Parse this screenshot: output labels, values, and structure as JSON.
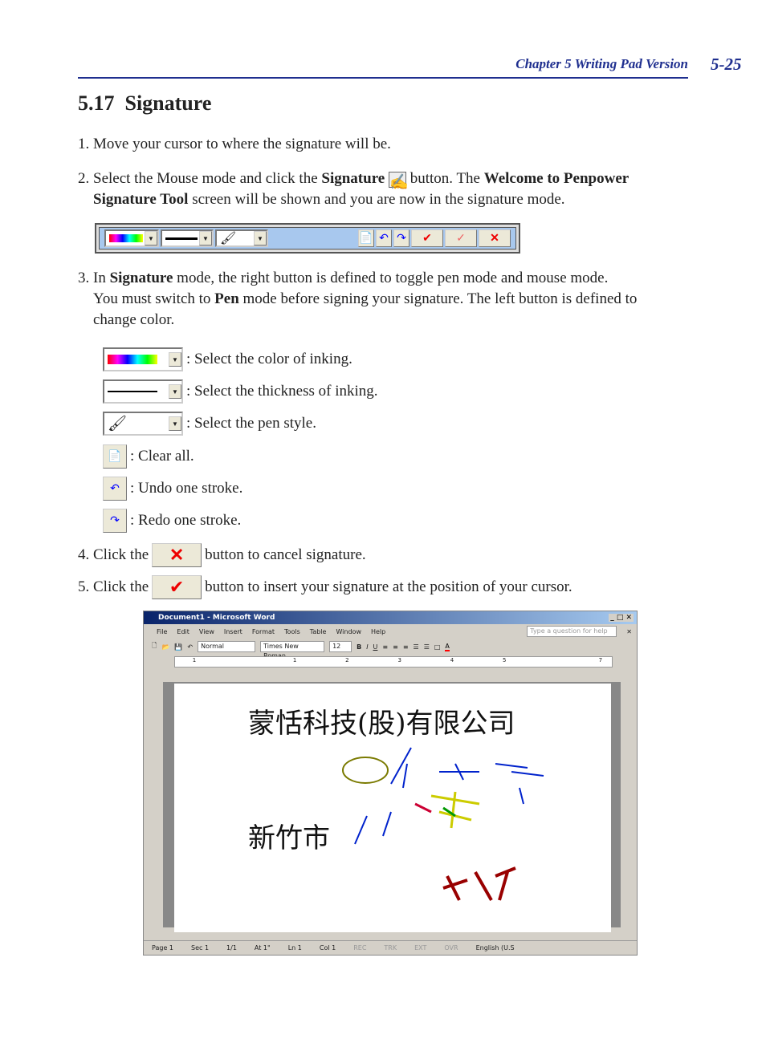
{
  "header": {
    "chapter": "Chapter 5 Writing Pad Version",
    "page": "5-25"
  },
  "section": {
    "number": "5.17",
    "title": "Signature"
  },
  "steps": {
    "s1": "1. Move your cursor to where the signature will be.",
    "s2a": "2. Select the Mouse mode and click the ",
    "s2b": "Signature",
    "s2c": " button. The ",
    "s2d": "Welcome to Penpower",
    "s2e": "Signature Tool",
    "s2f": " screen will be shown and you are now in the signature mode.",
    "s3a": "3. In ",
    "s3b": "Signature",
    "s3c": " mode, the right button is defined to toggle pen mode and mouse mode.",
    "s3d": "You must switch to ",
    "s3e": "Pen",
    "s3f": " mode before signing your signature. The left button is defined to",
    "s3g": "change color.",
    "s4a": "4.  Click the ",
    "s4b": "button to cancel signature.",
    "s5a": "5. Click the ",
    "s5b": "button to insert your signature at the position of your cursor."
  },
  "legend": [
    {
      "icon": "color-select",
      "text": ": Select the color of inking."
    },
    {
      "icon": "thickness-select",
      "text": ": Select the thickness of inking."
    },
    {
      "icon": "pen-style-select",
      "text": ": Select the pen style."
    },
    {
      "icon": "clear-all",
      "text": ": Clear all."
    },
    {
      "icon": "undo",
      "text": ": Undo one stroke."
    },
    {
      "icon": "redo",
      "text": ": Redo one stroke."
    }
  ],
  "word": {
    "title": "Document1 - Microsoft Word",
    "menu": [
      "File",
      "Edit",
      "View",
      "Insert",
      "Format",
      "Tools",
      "Table",
      "Window",
      "Help"
    ],
    "help_placeholder": "Type a question for help",
    "style": "Normal",
    "font": "Times New Roman",
    "size": "12",
    "ruler": [
      "1",
      "1",
      "2",
      "3",
      "4",
      "5",
      "7"
    ],
    "doc_text1": "蒙恬科技(股)有限公司",
    "doc_text2": "新竹市",
    "status": [
      "Page 1",
      "Sec 1",
      "1/1",
      "At 1\"",
      "Ln 1",
      "Col 1"
    ],
    "status_disabled": [
      "REC",
      "TRK",
      "EXT",
      "OVR"
    ],
    "language": "English (U.S"
  },
  "colors": {
    "accent": "#1f2f8f",
    "toolbar": "#a8c8ee",
    "check": "#e00000"
  }
}
